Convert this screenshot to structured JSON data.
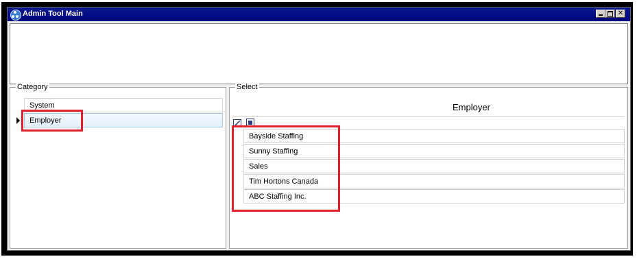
{
  "window": {
    "title": "Admin Tool Main",
    "controls": [
      "minimize",
      "maximize",
      "close"
    ],
    "close_glyph": "✕"
  },
  "category": {
    "legend": "Category",
    "items": [
      {
        "label": "System",
        "selected": false
      },
      {
        "label": "Employer",
        "selected": true
      }
    ]
  },
  "select": {
    "legend": "Select",
    "column_header": "Employer",
    "toolbar_icons": [
      "edit-icon",
      "stop-icon"
    ],
    "rows": [
      {
        "label": "Bayside Staffing"
      },
      {
        "label": "Sunny Staffing"
      },
      {
        "label": "Sales"
      },
      {
        "label": "Tim Hortons Canada"
      },
      {
        "label": "ABC Staffing Inc."
      }
    ]
  },
  "colors": {
    "titlebar": "#000080",
    "highlight": "#e0202a",
    "selected_row": "#e3f0fc"
  }
}
